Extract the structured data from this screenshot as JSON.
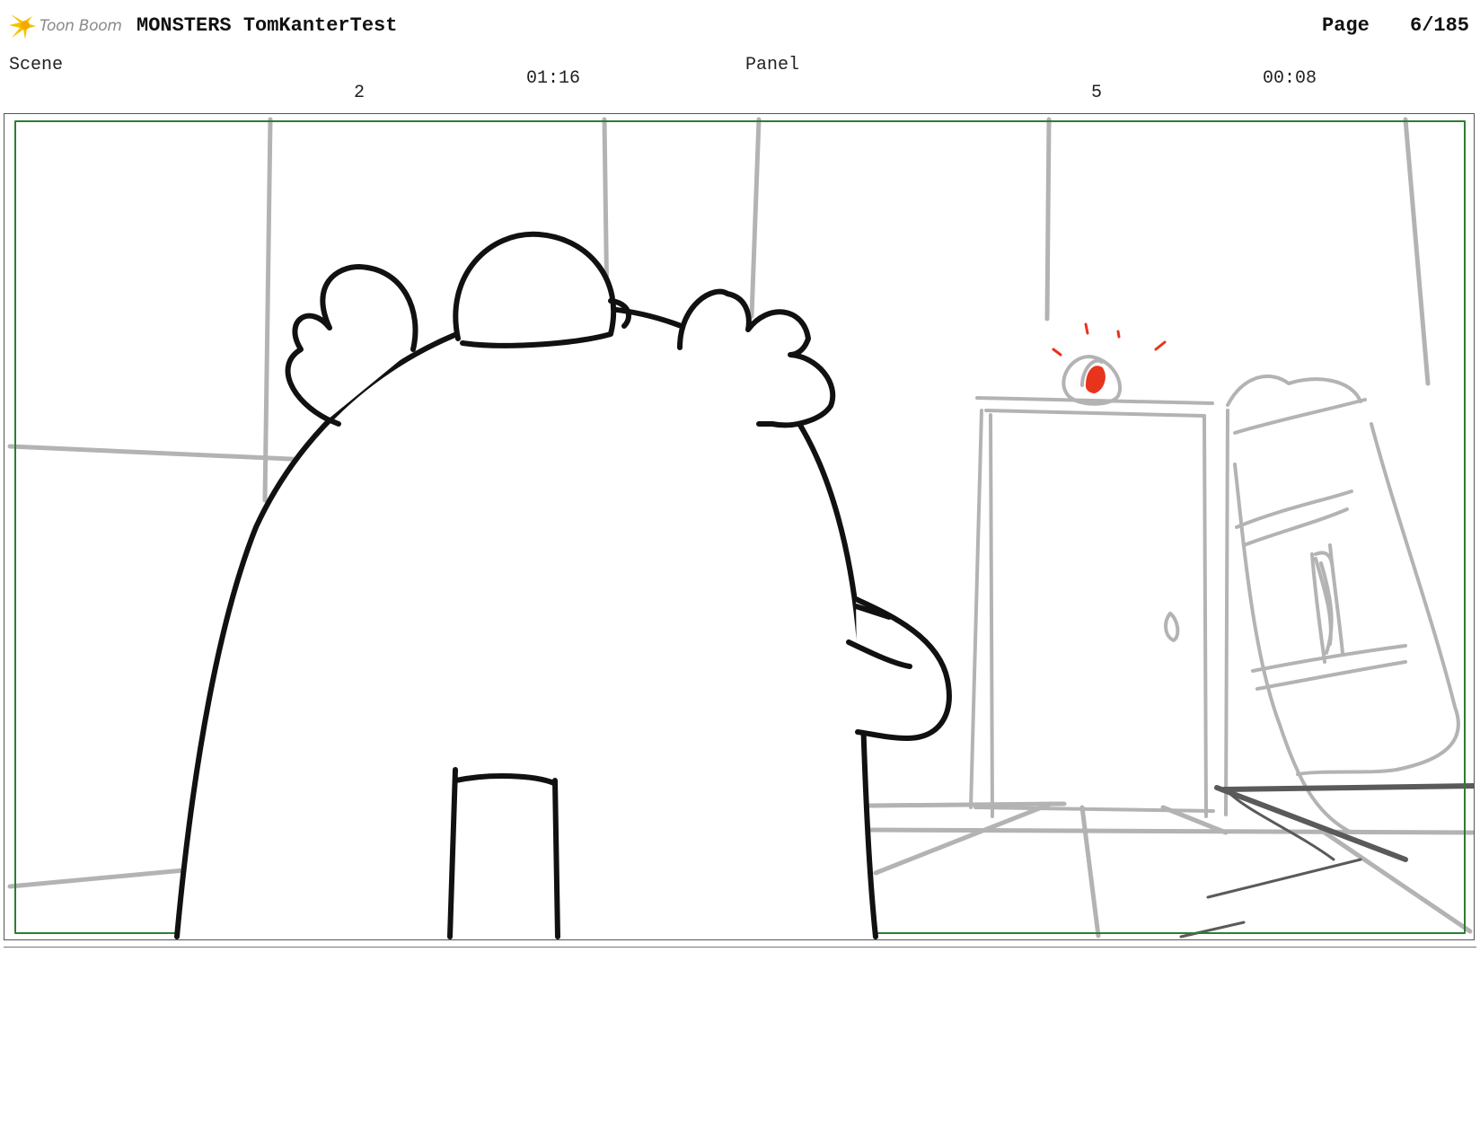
{
  "header": {
    "logo_text": "Toon Boom",
    "project_title": "MONSTERS TomKanterTest",
    "page_label": "Page",
    "page_number": "6/185"
  },
  "panel_info": {
    "scene_label": "Scene",
    "scene_number": "2",
    "scene_duration": "01:16",
    "panel_label": "Panel",
    "panel_number": "5",
    "panel_duration": "00:08"
  },
  "colors": {
    "safe_frame": "#2e7d32",
    "sketch_black": "#111111",
    "sketch_grey": "#b3b3b3",
    "alarm_red": "#e8341c",
    "logo_yellow": "#f5c400"
  }
}
